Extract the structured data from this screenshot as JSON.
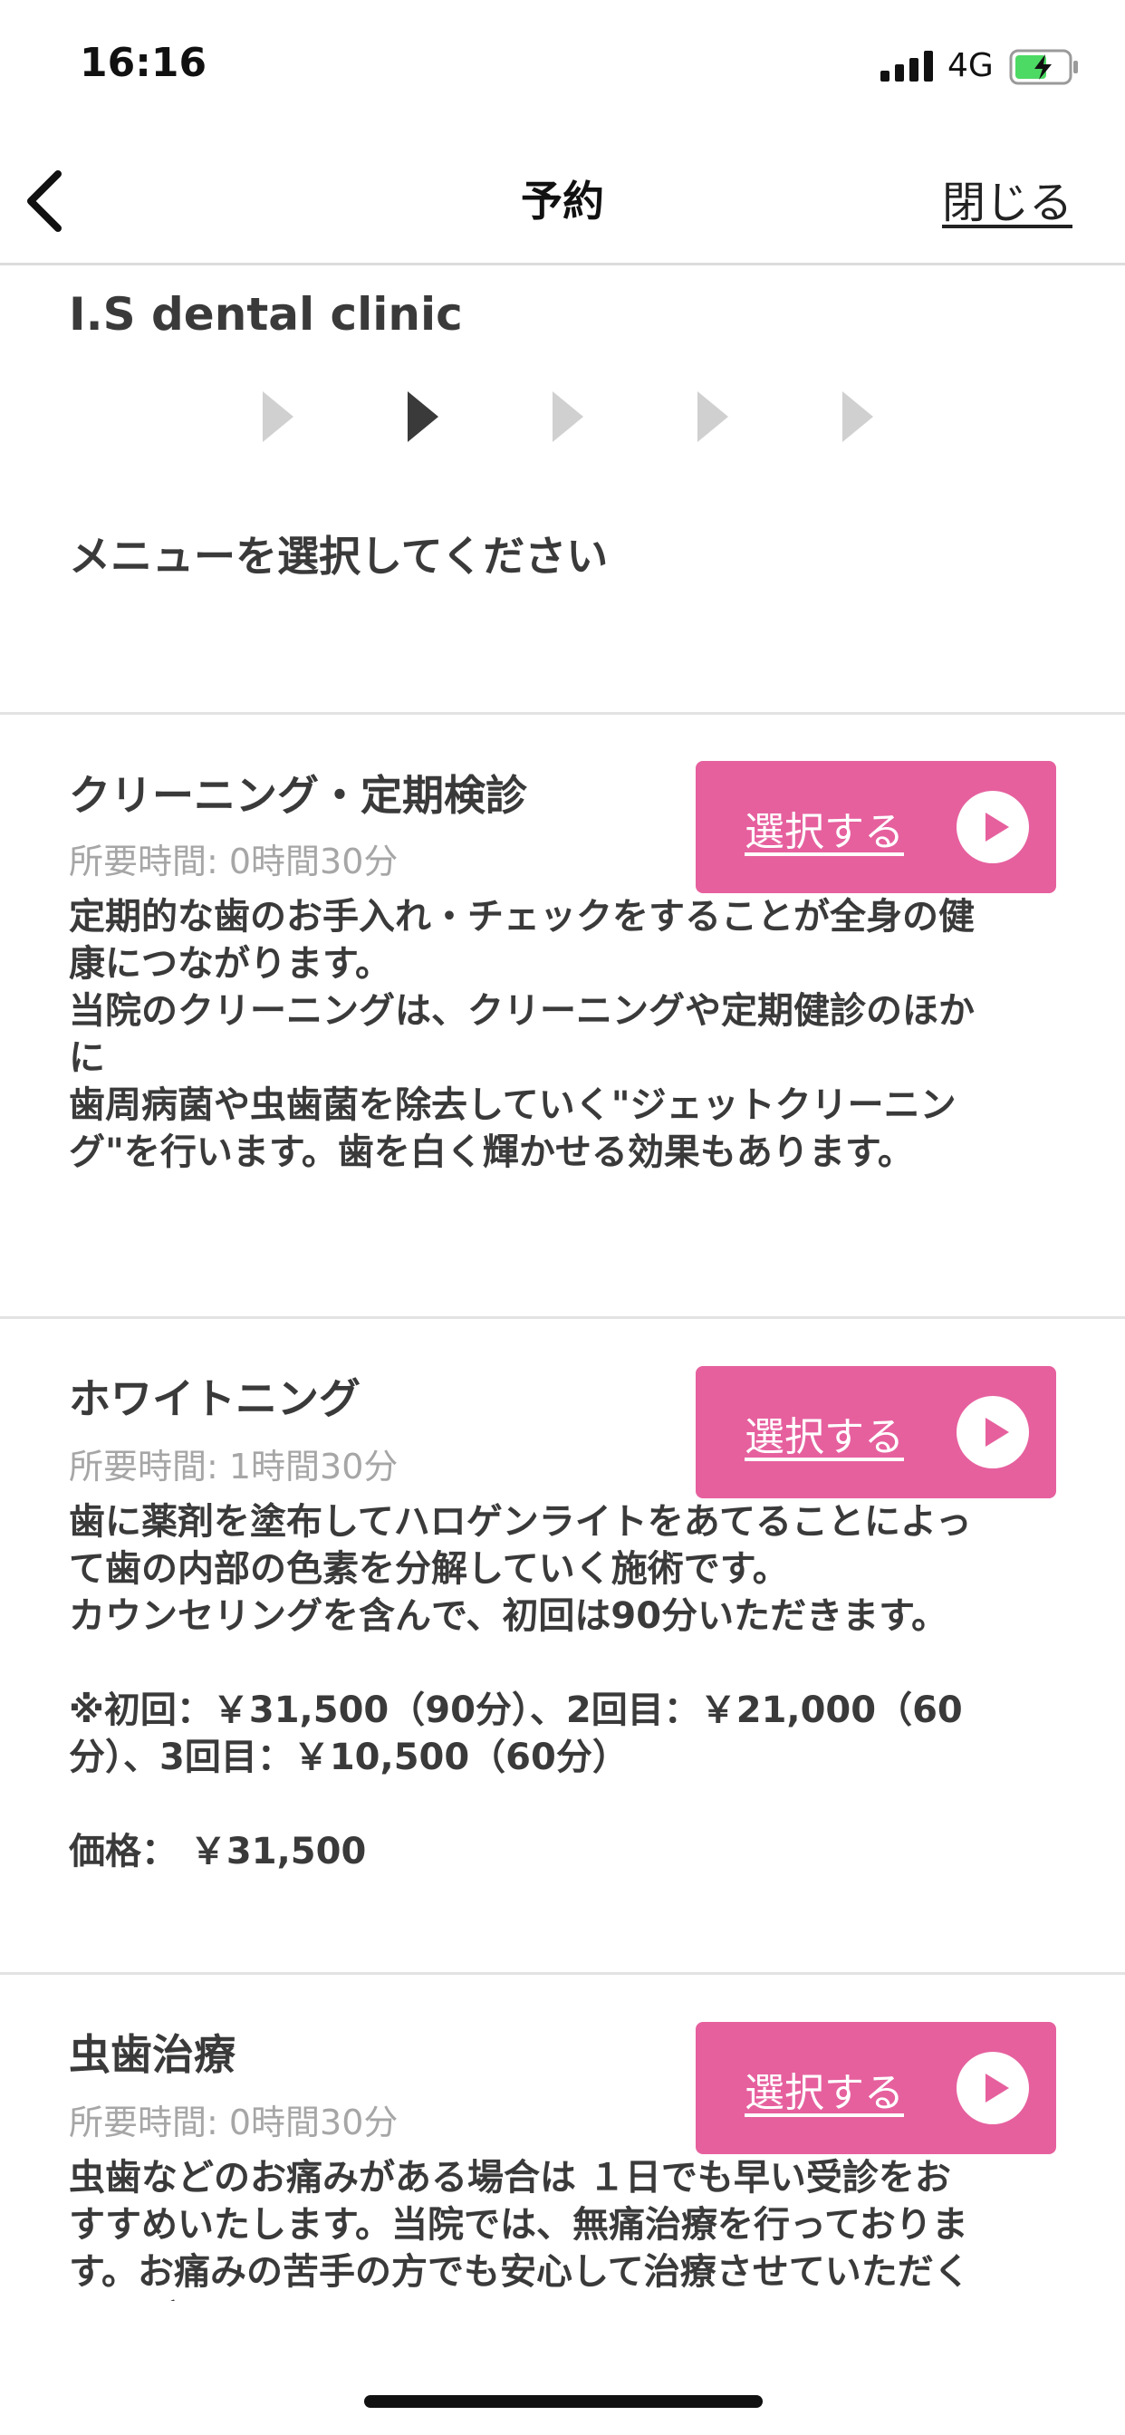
{
  "status": {
    "time": "16:16",
    "network": "4G",
    "icons": [
      "signal-icon",
      "battery-charging-icon"
    ]
  },
  "nav": {
    "title": "予約",
    "close": "閉じる",
    "back_icon": "chevron-left-icon"
  },
  "clinic": {
    "name": "I.S dental clinic"
  },
  "steps": {
    "count": 5,
    "current": 2,
    "icon": "triangle-right-icon"
  },
  "prompt": "メニューを選択してください",
  "colors": {
    "accent": "#e6609e",
    "step_active": "#3a3a3a",
    "step_inactive": "#d0d0d0",
    "divider": "#e3e3e3"
  },
  "menus": [
    {
      "name": "クリーニング・定期検診",
      "duration": "所要時間: 0時間30分",
      "button": "選択する",
      "description": "定期的な歯のお手入れ・チェックをすることが全身の健\n康につながります。\n当院のクリーニングは、クリーニングや定期健診のほか\nに\n歯周病菌や虫歯菌を除去していく\"ジェットクリーニン\nグ\"を行います。歯を白く輝かせる効果もあります。"
    },
    {
      "name": "ホワイトニング",
      "duration": "所要時間: 1時間30分",
      "button": "選択する",
      "description": "歯に薬剤を塗布してハロゲンライトをあてることによっ\nて歯の内部の色素を分解していく施術です。\nカウンセリングを含んで、初回は90分いただきます。\n\n※初回：￥31,500（90分）、2回目：￥21,000（60\n分）、3回目：￥10,500（60分）\n\n価格： ￥31,500"
    },
    {
      "name": "虫歯治療",
      "duration": "所要時間: 0時間30分",
      "button": "選択する",
      "description": "虫歯などのお痛みがある場合は １日でも早い受診をお\nすすめいたします。当院では、無痛治療を行っておりま\nす。お痛みの苦手の方でも安心して治療させていただく\nことができます。"
    }
  ]
}
